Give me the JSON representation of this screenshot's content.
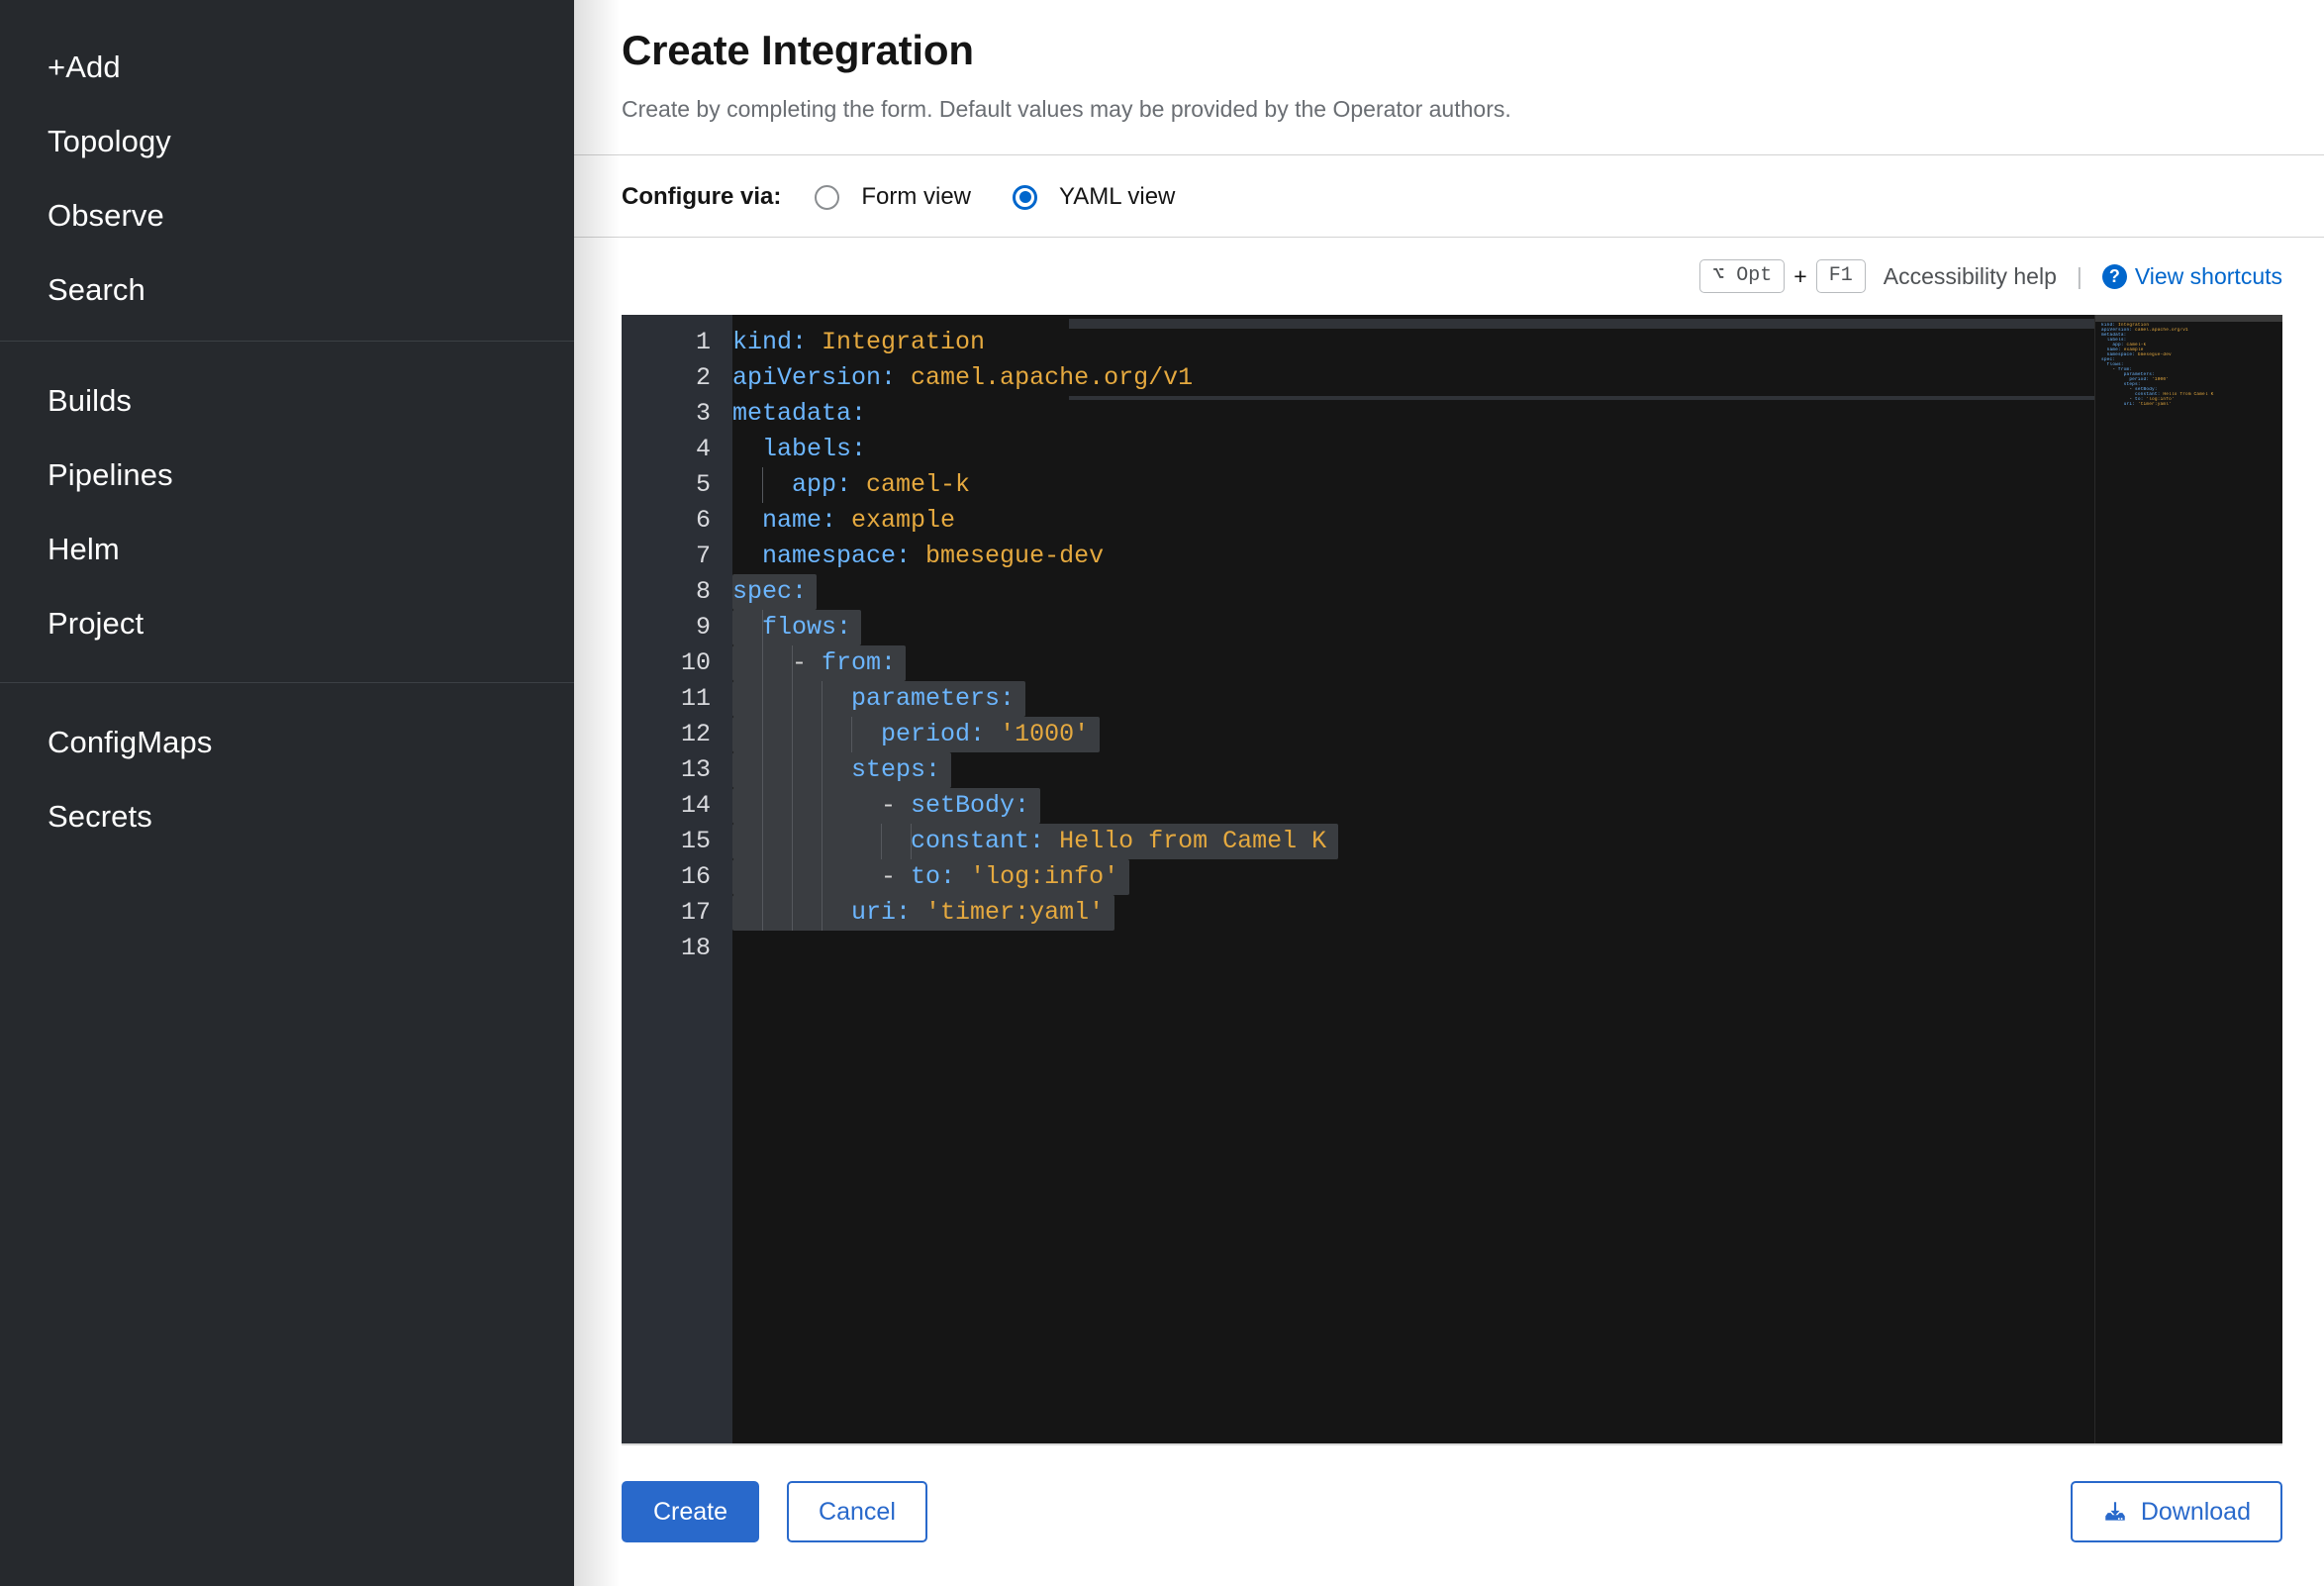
{
  "sidebar": {
    "groups": [
      {
        "items": [
          {
            "label": "+Add",
            "name": "sidebar-item-add"
          },
          {
            "label": "Topology",
            "name": "sidebar-item-topology"
          },
          {
            "label": "Observe",
            "name": "sidebar-item-observe"
          },
          {
            "label": "Search",
            "name": "sidebar-item-search"
          }
        ]
      },
      {
        "items": [
          {
            "label": "Builds",
            "name": "sidebar-item-builds"
          },
          {
            "label": "Pipelines",
            "name": "sidebar-item-pipelines"
          },
          {
            "label": "Helm",
            "name": "sidebar-item-helm"
          },
          {
            "label": "Project",
            "name": "sidebar-item-project"
          }
        ]
      },
      {
        "items": [
          {
            "label": "ConfigMaps",
            "name": "sidebar-item-configmaps"
          },
          {
            "label": "Secrets",
            "name": "sidebar-item-secrets"
          }
        ]
      }
    ]
  },
  "header": {
    "title": "Create Integration",
    "subtitle": "Create by completing the form. Default values may be provided by the Operator authors."
  },
  "configure": {
    "label": "Configure via:",
    "options": [
      {
        "label": "Form view",
        "selected": false
      },
      {
        "label": "YAML view",
        "selected": true
      }
    ]
  },
  "accessibility": {
    "key_modifier": "⌥ Opt",
    "key_plus": "+",
    "key_main": "F1",
    "help_text": "Accessibility help",
    "separator": "|",
    "help_icon": "question-circle-icon",
    "shortcuts_link": "View shortcuts"
  },
  "editor": {
    "language": "yaml",
    "line_numbers": [
      "1",
      "2",
      "3",
      "4",
      "5",
      "6",
      "7",
      "8",
      "9",
      "10",
      "11",
      "12",
      "13",
      "14",
      "15",
      "16",
      "17",
      "18"
    ],
    "lines": [
      {
        "n": 1,
        "indent": 0,
        "segments": [
          {
            "t": "kind:",
            "c": "k"
          },
          {
            "t": " ",
            "c": "p"
          },
          {
            "t": "Integration",
            "c": "v"
          }
        ]
      },
      {
        "n": 2,
        "indent": 0,
        "segments": [
          {
            "t": "apiVersion:",
            "c": "k"
          },
          {
            "t": " ",
            "c": "p"
          },
          {
            "t": "camel.apache.org/v1",
            "c": "v"
          }
        ]
      },
      {
        "n": 3,
        "indent": 0,
        "segments": [
          {
            "t": "metadata:",
            "c": "k"
          }
        ]
      },
      {
        "n": 4,
        "indent": 2,
        "segments": [
          {
            "t": "  labels:",
            "c": "k"
          }
        ]
      },
      {
        "n": 5,
        "indent": 4,
        "segments": [
          {
            "t": "    app:",
            "c": "k"
          },
          {
            "t": " ",
            "c": "p"
          },
          {
            "t": "camel-k",
            "c": "v"
          }
        ]
      },
      {
        "n": 6,
        "indent": 2,
        "segments": [
          {
            "t": "  name:",
            "c": "k"
          },
          {
            "t": " ",
            "c": "p"
          },
          {
            "t": "example",
            "c": "v"
          }
        ]
      },
      {
        "n": 7,
        "indent": 2,
        "segments": [
          {
            "t": "  namespace:",
            "c": "k"
          },
          {
            "t": " ",
            "c": "p"
          },
          {
            "t": "bmesegue-dev",
            "c": "v"
          }
        ]
      },
      {
        "n": 8,
        "indent": 0,
        "segments": [
          {
            "t": "spec:",
            "c": "k"
          }
        ]
      },
      {
        "n": 9,
        "indent": 2,
        "segments": [
          {
            "t": "  flows:",
            "c": "k"
          }
        ]
      },
      {
        "n": 10,
        "indent": 4,
        "segments": [
          {
            "t": "    - ",
            "c": "p"
          },
          {
            "t": "from:",
            "c": "k"
          }
        ]
      },
      {
        "n": 11,
        "indent": 8,
        "segments": [
          {
            "t": "        parameters:",
            "c": "k"
          }
        ]
      },
      {
        "n": 12,
        "indent": 10,
        "segments": [
          {
            "t": "          period:",
            "c": "k"
          },
          {
            "t": " ",
            "c": "p"
          },
          {
            "t": "'1000'",
            "c": "v"
          }
        ]
      },
      {
        "n": 13,
        "indent": 8,
        "segments": [
          {
            "t": "        steps:",
            "c": "k"
          }
        ]
      },
      {
        "n": 14,
        "indent": 10,
        "segments": [
          {
            "t": "          - ",
            "c": "p"
          },
          {
            "t": "setBody:",
            "c": "k"
          }
        ]
      },
      {
        "n": 15,
        "indent": 12,
        "segments": [
          {
            "t": "            constant:",
            "c": "k"
          },
          {
            "t": " ",
            "c": "p"
          },
          {
            "t": "Hello from Camel K",
            "c": "v"
          }
        ]
      },
      {
        "n": 16,
        "indent": 10,
        "segments": [
          {
            "t": "          - ",
            "c": "p"
          },
          {
            "t": "to:",
            "c": "k"
          },
          {
            "t": " ",
            "c": "p"
          },
          {
            "t": "'log:info'",
            "c": "v"
          }
        ]
      },
      {
        "n": 17,
        "indent": 8,
        "segments": [
          {
            "t": "        uri:",
            "c": "k"
          },
          {
            "t": " ",
            "c": "p"
          },
          {
            "t": "'timer:yaml'",
            "c": "v"
          }
        ]
      },
      {
        "n": 18,
        "indent": 0,
        "segments": []
      }
    ],
    "minimap_label": "code-minimap"
  },
  "footer": {
    "create_label": "Create",
    "cancel_label": "Cancel",
    "download_label": "Download",
    "download_icon": "download-icon"
  },
  "colors": {
    "accent_blue": "#2969cb",
    "link_blue": "#0066cc",
    "sidebar_bg": "#26292d",
    "editor_bg": "#151515",
    "gutter_bg": "#2b2f36",
    "yaml_key": "#6cb6ff",
    "yaml_value": "#e5a93f",
    "selection": "#3a3d41"
  }
}
